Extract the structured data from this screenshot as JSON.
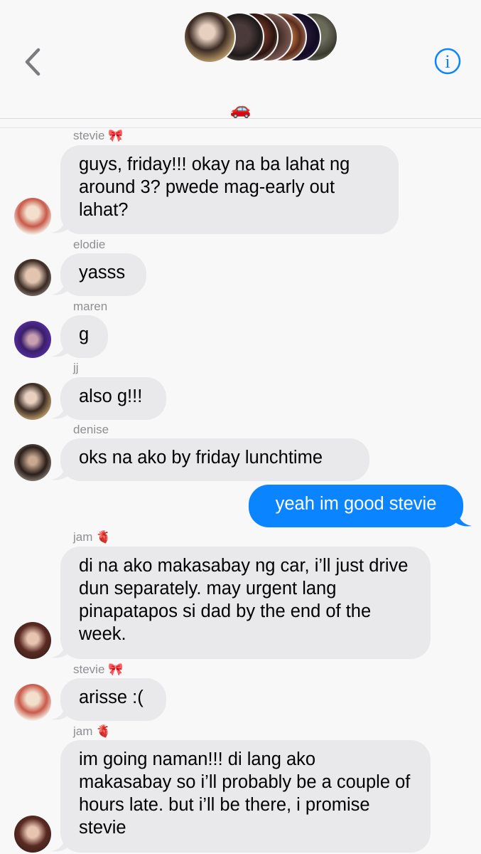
{
  "header": {
    "group_name": "🚗",
    "back_icon": "chevron-left-icon",
    "info_icon": "info-circle-icon",
    "info_label": "i"
  },
  "messages": [
    {
      "sender": "stevie 🎀",
      "text": "guys, friday!!! okay na ba lahat ng around 3? pwede mag-early out lahat?"
    },
    {
      "sender": "elodie",
      "text": "yasss"
    },
    {
      "sender": "maren",
      "text": "g"
    },
    {
      "sender": "jj",
      "text": "also g!!!"
    },
    {
      "sender": "denise",
      "text": "oks na ako by friday lunchtime"
    },
    {
      "sender": "",
      "text": "yeah im good stevie"
    },
    {
      "sender": "jam 🫀",
      "text": "di na ako makasabay ng car, i’ll just drive dun separately. may urgent lang pinapatapos si dad by the end of the week."
    },
    {
      "sender": "stevie 🎀",
      "text": "arisse :("
    },
    {
      "sender": "jam 🫀",
      "text": "im going naman!!! di lang ako makasabay so i’ll probably be a couple of hours late. but i’ll be there, i promise stevie"
    }
  ],
  "colors": {
    "incoming_bubble": "#e9e9eb",
    "outgoing_bubble": "#0b84ff",
    "accent": "#0a84ff"
  }
}
